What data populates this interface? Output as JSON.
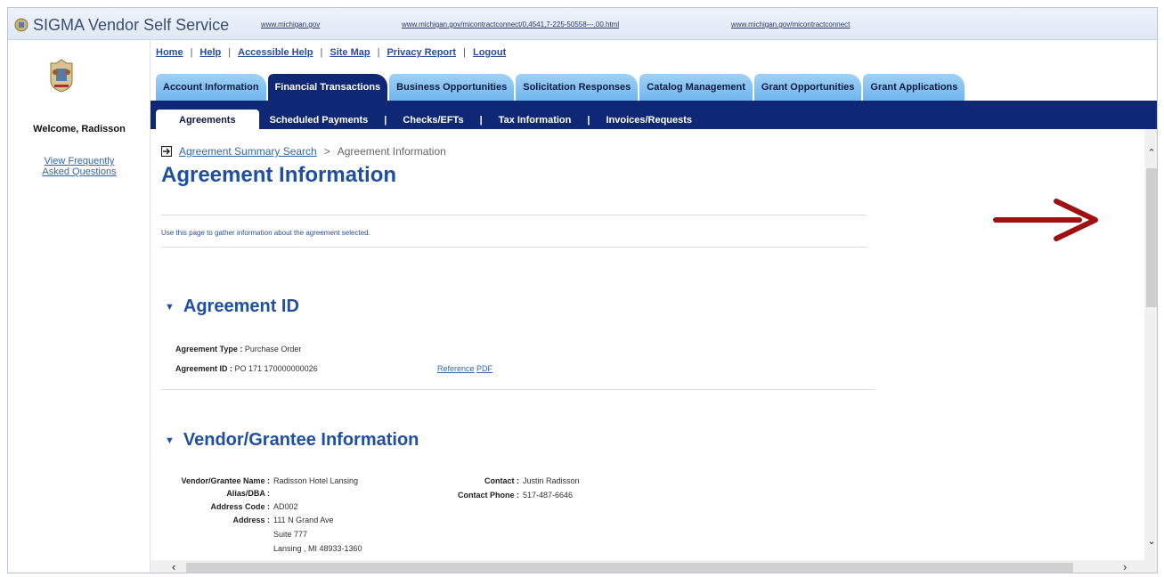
{
  "header": {
    "app_title": "SIGMA Vendor Self Service",
    "links": [
      "www.michigan.gov",
      "www.michigan.gov/micontractconnect/0,4541,7-225-50558---,00.html",
      "www.michigan.gov/micontractconnect"
    ]
  },
  "sidebar": {
    "welcome": "Welcome, Radisson",
    "faq_link": "View Frequently Asked Questions"
  },
  "nav": {
    "home": "Home",
    "help": "Help",
    "accessible_help": "Accessible Help",
    "site_map": "Site Map",
    "privacy_report": "Privacy Report",
    "logout": "Logout",
    "separator": "|"
  },
  "tabs": [
    {
      "label": "Account Information",
      "active": false
    },
    {
      "label": "Financial Transactions",
      "active": true
    },
    {
      "label": "Business Opportunities",
      "active": false
    },
    {
      "label": "Solicitation Responses",
      "active": false
    },
    {
      "label": "Catalog Management",
      "active": false
    },
    {
      "label": "Grant Opportunities",
      "active": false
    },
    {
      "label": "Grant Applications",
      "active": false
    }
  ],
  "subtabs": [
    "Agreements",
    "Scheduled Payments",
    "Checks/EFTs",
    "Tax Information",
    "Invoices/Requests"
  ],
  "breadcrumb": {
    "link": "Agreement Summary Search",
    "separator": ">",
    "current": "Agreement Information"
  },
  "page": {
    "title": "Agreement Information",
    "intro": "Use this page to gather information about the agreement selected."
  },
  "agreement_section": {
    "heading": "Agreement ID",
    "type_label": "Agreement Type :",
    "type_value": "Purchase Order",
    "id_label": "Agreement ID :",
    "id_value": "PO 171 170000000026",
    "reference_link": "Reference",
    "pdf_link": "PDF"
  },
  "vendor_section": {
    "heading": "Vendor/Grantee Information",
    "name_label": "Vendor/Grantee Name :",
    "name_value": "Radisson Hotel Lansing",
    "alias_label": "Alias/DBA :",
    "alias_value": "",
    "address_code_label": "Address Code :",
    "address_code_value": "AD002",
    "address_label": "Address :",
    "address_line1": "111 N Grand Ave",
    "address_line2": "Suite 777",
    "address_line3": "Lansing , MI 48933-1360",
    "contact_label": "Contact :",
    "contact_value": "Justin Radisson",
    "contact_phone_label": "Contact Phone :",
    "contact_phone_value": "517-487-6646"
  },
  "colors": {
    "nav_blue": "#0e2876",
    "tab_light": "#8cc5f3",
    "heading_blue": "#1f4fa3",
    "arrow_red": "#a01010"
  },
  "icons": {
    "arrow": "red-arrow-right",
    "breadcrumb": "export-icon",
    "collapse": "caret-down-icon"
  }
}
